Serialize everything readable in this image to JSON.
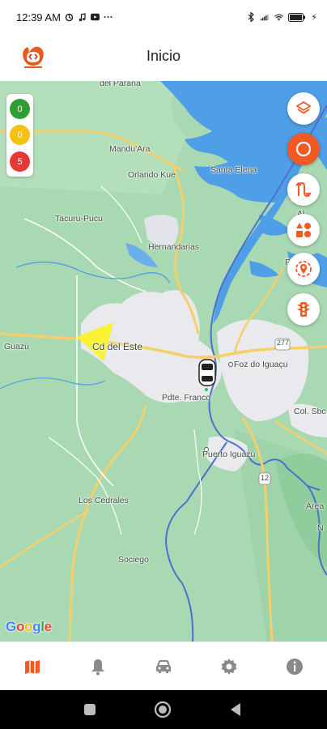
{
  "status_bar": {
    "time": "12:39 AM",
    "battery_indicator": "⚡",
    "icons": [
      "sync-icon",
      "music-note-icon",
      "youtube-icon",
      "more-dots-icon",
      "bluetooth-icon",
      "signal-icon",
      "wifi-icon",
      "battery-icon"
    ]
  },
  "header": {
    "title": "Inicio",
    "logo_icon": "app-logo-icon"
  },
  "counters": [
    {
      "value": "0",
      "color": "#2e9e35"
    },
    {
      "value": "0",
      "color": "#f4c20d"
    },
    {
      "value": "5",
      "color": "#e53935"
    }
  ],
  "map": {
    "labels": [
      "del Paraná",
      "Mandu'Ara",
      "Orlando Kue",
      "Santa Elena",
      "Tacuru-Pucu",
      "Hernandarias",
      "Alvorada do Paraná",
      "Porto Mendes",
      "Guazú",
      "Ciudad del Este",
      "Foz do Iguaçu",
      "Pdte. Franco",
      "Col. Sbc",
      "Puerto Iguazú",
      "Los Cedrales",
      "Área Nacional",
      "Sociego",
      "Sociego",
      "277",
      "12"
    ],
    "labels_shown": [
      "del Paraná",
      "Mandu'Ara",
      "Orlando Kue",
      "Santa Elena",
      "Tacuru-Pucu",
      "Hernandarias",
      "Al",
      "do",
      "Porto",
      "Guazú",
      "Cd del Este",
      "Foz do Iguaçu",
      "Pdte. Franco",
      "Col. Sbc",
      "Puerto Iguazú",
      "Los Cedrales",
      "Área",
      "N",
      "Sociego",
      "277",
      "12"
    ],
    "attribution": [
      "G",
      "o",
      "o",
      "g",
      "l",
      "e"
    ],
    "colors": {
      "land": "#a9d9b3",
      "water": "#4f9fe8",
      "urban": "#e9e9ee",
      "road": "#f6cf6b",
      "accent": "#f15a22"
    }
  },
  "fab_buttons": [
    {
      "icon": "layers-icon",
      "active": false
    },
    {
      "icon": "circle-record-icon",
      "active": true
    },
    {
      "icon": "route-icon",
      "active": false
    },
    {
      "icon": "categories-icon",
      "active": false
    },
    {
      "icon": "location-pin-icon",
      "active": false
    },
    {
      "icon": "traffic-light-icon",
      "active": false
    }
  ],
  "bottom_nav": [
    {
      "icon": "map-icon",
      "active": true
    },
    {
      "icon": "notifications-icon",
      "active": false
    },
    {
      "icon": "vehicle-icon",
      "active": false
    },
    {
      "icon": "settings-icon",
      "active": false
    },
    {
      "icon": "info-icon",
      "active": false
    }
  ],
  "system_nav": [
    "recent-apps-icon",
    "home-icon",
    "back-icon"
  ]
}
